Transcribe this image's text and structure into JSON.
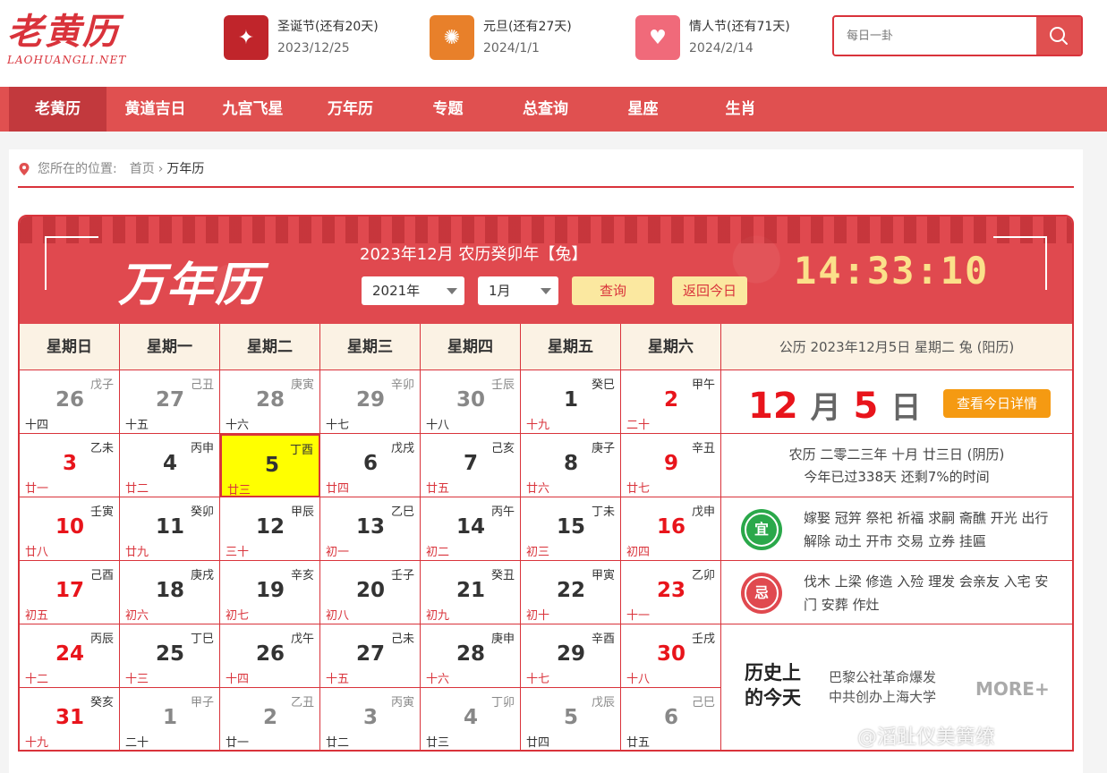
{
  "logo": {
    "cn": "老黄历",
    "en": "LAOHUANGLI.NET"
  },
  "festivals": [
    {
      "name": "圣诞节(还有20天)",
      "date": "2023/12/25",
      "icon": "christmas-card-icon",
      "color": "#c0252b"
    },
    {
      "name": "元旦(还有27天)",
      "date": "2024/1/1",
      "icon": "new-year-icon",
      "color": "#e8802a"
    },
    {
      "name": "情人节(还有71天)",
      "date": "2024/2/14",
      "icon": "heart-icon",
      "color": "#f06a7a"
    }
  ],
  "search": {
    "placeholder": "每日一卦"
  },
  "nav": [
    "老黄历",
    "黄道吉日",
    "九宫飞星",
    "万年历",
    "专题",
    "总查询",
    "星座",
    "生肖"
  ],
  "breadcrumb": {
    "label": "您所在的位置:",
    "home": "首页",
    "current": "万年历"
  },
  "calendar": {
    "banner_title": "万年历",
    "month_title": "2023年12月 农历癸卯年【兔】",
    "year_select": "2021年",
    "month_select": "1月",
    "query_button": "查询",
    "today_button": "返回今日",
    "clock": "14:33:10",
    "weekdays": [
      "星期日",
      "星期一",
      "星期二",
      "星期三",
      "星期四",
      "星期五",
      "星期六"
    ],
    "weeks": [
      [
        {
          "d": "26",
          "gz": "戊子",
          "lun": "十四",
          "dim": true
        },
        {
          "d": "27",
          "gz": "己丑",
          "lun": "十五",
          "dim": true
        },
        {
          "d": "28",
          "gz": "庚寅",
          "lun": "十六",
          "dim": true
        },
        {
          "d": "29",
          "gz": "辛卯",
          "lun": "十七",
          "dim": true
        },
        {
          "d": "30",
          "gz": "壬辰",
          "lun": "十八",
          "dim": true
        },
        {
          "d": "1",
          "gz": "癸巳",
          "lun": "十九"
        },
        {
          "d": "2",
          "gz": "甲午",
          "lun": "二十"
        }
      ],
      [
        {
          "d": "3",
          "gz": "乙未",
          "lun": "廿一"
        },
        {
          "d": "4",
          "gz": "丙申",
          "lun": "廿二"
        },
        {
          "d": "5",
          "gz": "丁酉",
          "lun": "廿三",
          "today": true
        },
        {
          "d": "6",
          "gz": "戊戌",
          "lun": "廿四"
        },
        {
          "d": "7",
          "gz": "己亥",
          "lun": "廿五"
        },
        {
          "d": "8",
          "gz": "庚子",
          "lun": "廿六"
        },
        {
          "d": "9",
          "gz": "辛丑",
          "lun": "廿七"
        }
      ],
      [
        {
          "d": "10",
          "gz": "壬寅",
          "lun": "廿八"
        },
        {
          "d": "11",
          "gz": "癸卯",
          "lun": "廿九"
        },
        {
          "d": "12",
          "gz": "甲辰",
          "lun": "三十"
        },
        {
          "d": "13",
          "gz": "乙巳",
          "lun": "初一"
        },
        {
          "d": "14",
          "gz": "丙午",
          "lun": "初二"
        },
        {
          "d": "15",
          "gz": "丁未",
          "lun": "初三"
        },
        {
          "d": "16",
          "gz": "戊申",
          "lun": "初四"
        }
      ],
      [
        {
          "d": "17",
          "gz": "己酉",
          "lun": "初五"
        },
        {
          "d": "18",
          "gz": "庚戌",
          "lun": "初六"
        },
        {
          "d": "19",
          "gz": "辛亥",
          "lun": "初七"
        },
        {
          "d": "20",
          "gz": "壬子",
          "lun": "初八"
        },
        {
          "d": "21",
          "gz": "癸丑",
          "lun": "初九"
        },
        {
          "d": "22",
          "gz": "甲寅",
          "lun": "初十"
        },
        {
          "d": "23",
          "gz": "乙卯",
          "lun": "十一"
        }
      ],
      [
        {
          "d": "24",
          "gz": "丙辰",
          "lun": "十二"
        },
        {
          "d": "25",
          "gz": "丁巳",
          "lun": "十三"
        },
        {
          "d": "26",
          "gz": "戊午",
          "lun": "十四"
        },
        {
          "d": "27",
          "gz": "己未",
          "lun": "十五"
        },
        {
          "d": "28",
          "gz": "庚申",
          "lun": "十六"
        },
        {
          "d": "29",
          "gz": "辛酉",
          "lun": "十七"
        },
        {
          "d": "30",
          "gz": "壬戌",
          "lun": "十八"
        }
      ],
      [
        {
          "d": "31",
          "gz": "癸亥",
          "lun": "十九"
        },
        {
          "d": "1",
          "gz": "甲子",
          "lun": "二十",
          "dim": true
        },
        {
          "d": "2",
          "gz": "乙丑",
          "lun": "廿一",
          "dim": true
        },
        {
          "d": "3",
          "gz": "丙寅",
          "lun": "廿二",
          "dim": true
        },
        {
          "d": "4",
          "gz": "丁卯",
          "lun": "廿三",
          "dim": true
        },
        {
          "d": "5",
          "gz": "戊辰",
          "lun": "廿四",
          "dim": true
        },
        {
          "d": "6",
          "gz": "己巳",
          "lun": "廿五",
          "dim": true
        }
      ]
    ]
  },
  "panel": {
    "solar": "公历 2023年12月5日 星期二 兔 (阳历)",
    "month": "12",
    "month_unit": "月",
    "day": "5",
    "day_unit": "日",
    "detail_button": "查看今日详情",
    "lunar": "农历 二零二三年 十月 廿三日 (阴历)",
    "progress": "今年已过338天 还剩7%的时间",
    "yi_label": "宜",
    "yi": "嫁娶 冠笄 祭祀 祈福 求嗣 斋醮 开光 出行 解除 动土 开市 交易 立券 挂匾",
    "ji_label": "忌",
    "ji": "伐木 上梁 修造 入殓 理发 会亲友 入宅 安门 安葬 作灶",
    "history_title_1": "历史上",
    "history_title_2": "的今天",
    "history": [
      "巴黎公社革命爆发",
      "中共创办上海大学"
    ],
    "more": "MORE+"
  },
  "watermark": "@滔趾仪美簧缭"
}
